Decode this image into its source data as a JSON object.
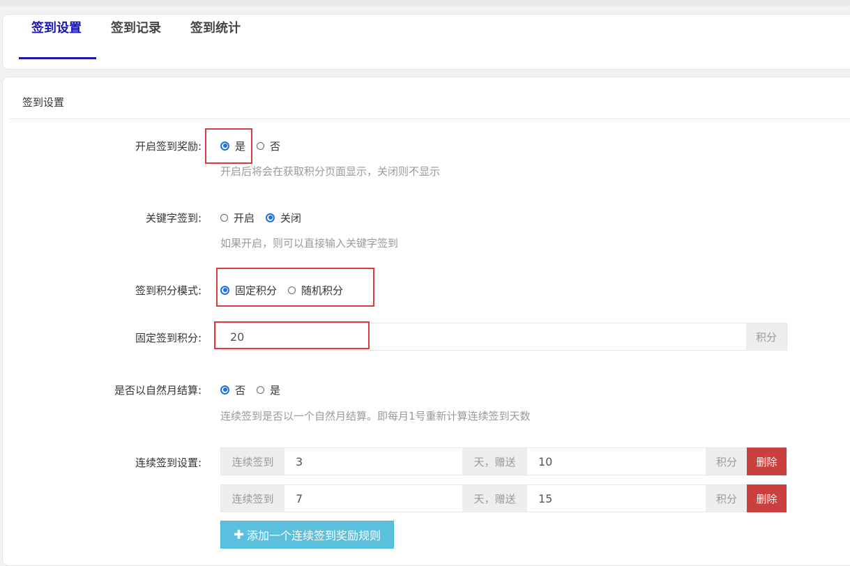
{
  "tabs": [
    {
      "label": "签到设置",
      "active": true
    },
    {
      "label": "签到记录",
      "active": false
    },
    {
      "label": "签到统计",
      "active": false
    }
  ],
  "section_title": "签到设置",
  "fields": {
    "enable_reward": {
      "label": "开启签到奖励:",
      "options": [
        {
          "label": "是",
          "checked": true
        },
        {
          "label": "否",
          "checked": false
        }
      ],
      "hint": "开启后将会在获取积分页面显示，关闭则不显示"
    },
    "keyword_signin": {
      "label": "关键字签到:",
      "options": [
        {
          "label": "开启",
          "checked": false
        },
        {
          "label": "关闭",
          "checked": true
        }
      ],
      "hint": "如果开启，则可以直接输入关键字签到"
    },
    "points_mode": {
      "label": "签到积分模式:",
      "options": [
        {
          "label": "固定积分",
          "checked": true
        },
        {
          "label": "随机积分",
          "checked": false
        }
      ]
    },
    "fixed_points": {
      "label": "固定签到积分:",
      "value": "20",
      "suffix": "积分"
    },
    "natural_month": {
      "label": "是否以自然月结算:",
      "options": [
        {
          "label": "否",
          "checked": true
        },
        {
          "label": "是",
          "checked": false
        }
      ],
      "hint": "连续签到是否以一个自然月结算。即每月1号重新计算连续签到天数"
    },
    "streak": {
      "label": "连续签到设置:",
      "prefix": "连续签到",
      "middle": "天，赠送",
      "suffix": "积分",
      "delete_label": "删除",
      "rules": [
        {
          "days": "3",
          "points": "10"
        },
        {
          "days": "7",
          "points": "15"
        }
      ],
      "add_label": "添加一个连续签到奖励规则"
    }
  },
  "colors": {
    "tab_active": "#1a17b0",
    "radio_checked": "#1f6fe0",
    "highlight_box": "#d93a3a",
    "delete_button": "#c9403e",
    "add_button": "#5bc0de"
  }
}
